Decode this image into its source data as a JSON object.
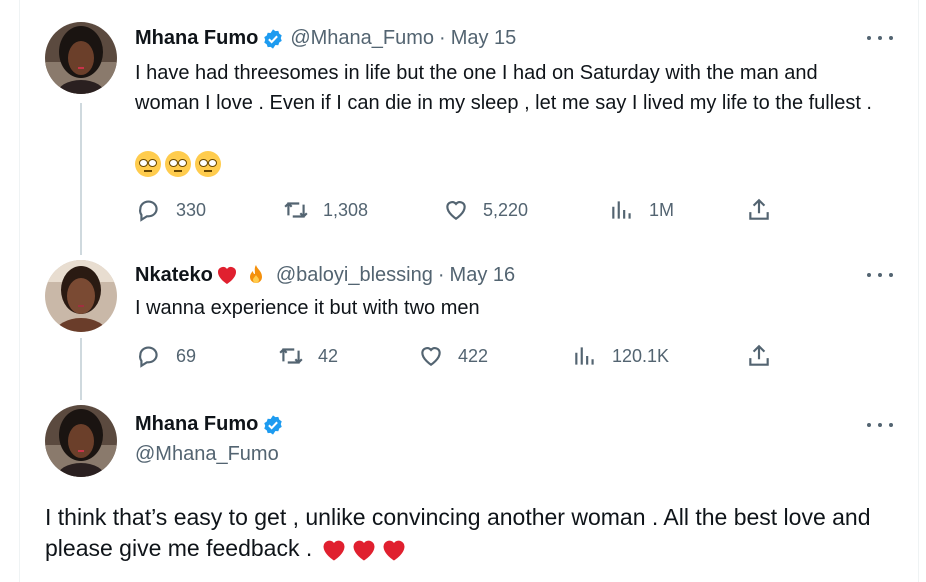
{
  "tweets": [
    {
      "name": "Mhana Fumo",
      "handle": "@Mhana_Fumo",
      "separator": "·",
      "date": "May 15",
      "text": "I have had threesomes in life but the one I had on Saturday with the man and woman I love . Even if I can die in my sleep , let me say I lived my life to the fullest .",
      "emoji_icon": "face-with-rolling-eyes-emoji",
      "emoji_count": 3,
      "replies": "330",
      "retweets": "1,308",
      "likes": "5,220",
      "views": "1M"
    },
    {
      "name": "Nkateko",
      "name_icons": [
        "red-heart-emoji",
        "fire-emoji"
      ],
      "handle": "@baloyi_blessing",
      "separator": "·",
      "date": "May 16",
      "text": "I wanna experience it but with two men",
      "replies": "69",
      "retweets": "42",
      "likes": "422",
      "views": "120.1K"
    },
    {
      "name": "Mhana Fumo",
      "handle": "@Mhana_Fumo",
      "text": "I think that’s easy to get , unlike convincing another woman . All the best love and please give me feedback .",
      "emoji_icon": "red-heart-emoji",
      "emoji_count": 3
    }
  ],
  "colors": {
    "text": "#0f1419",
    "secondary": "#536471",
    "verified": "#1d9bf0",
    "thread_line": "#cfd9de",
    "heart": "#e0202f"
  },
  "icons": {
    "reply": "reply-icon",
    "retweet": "retweet-icon",
    "like": "like-icon",
    "views": "views-icon",
    "share": "share-icon",
    "more": "more-icon",
    "verified": "verified-badge-icon"
  }
}
